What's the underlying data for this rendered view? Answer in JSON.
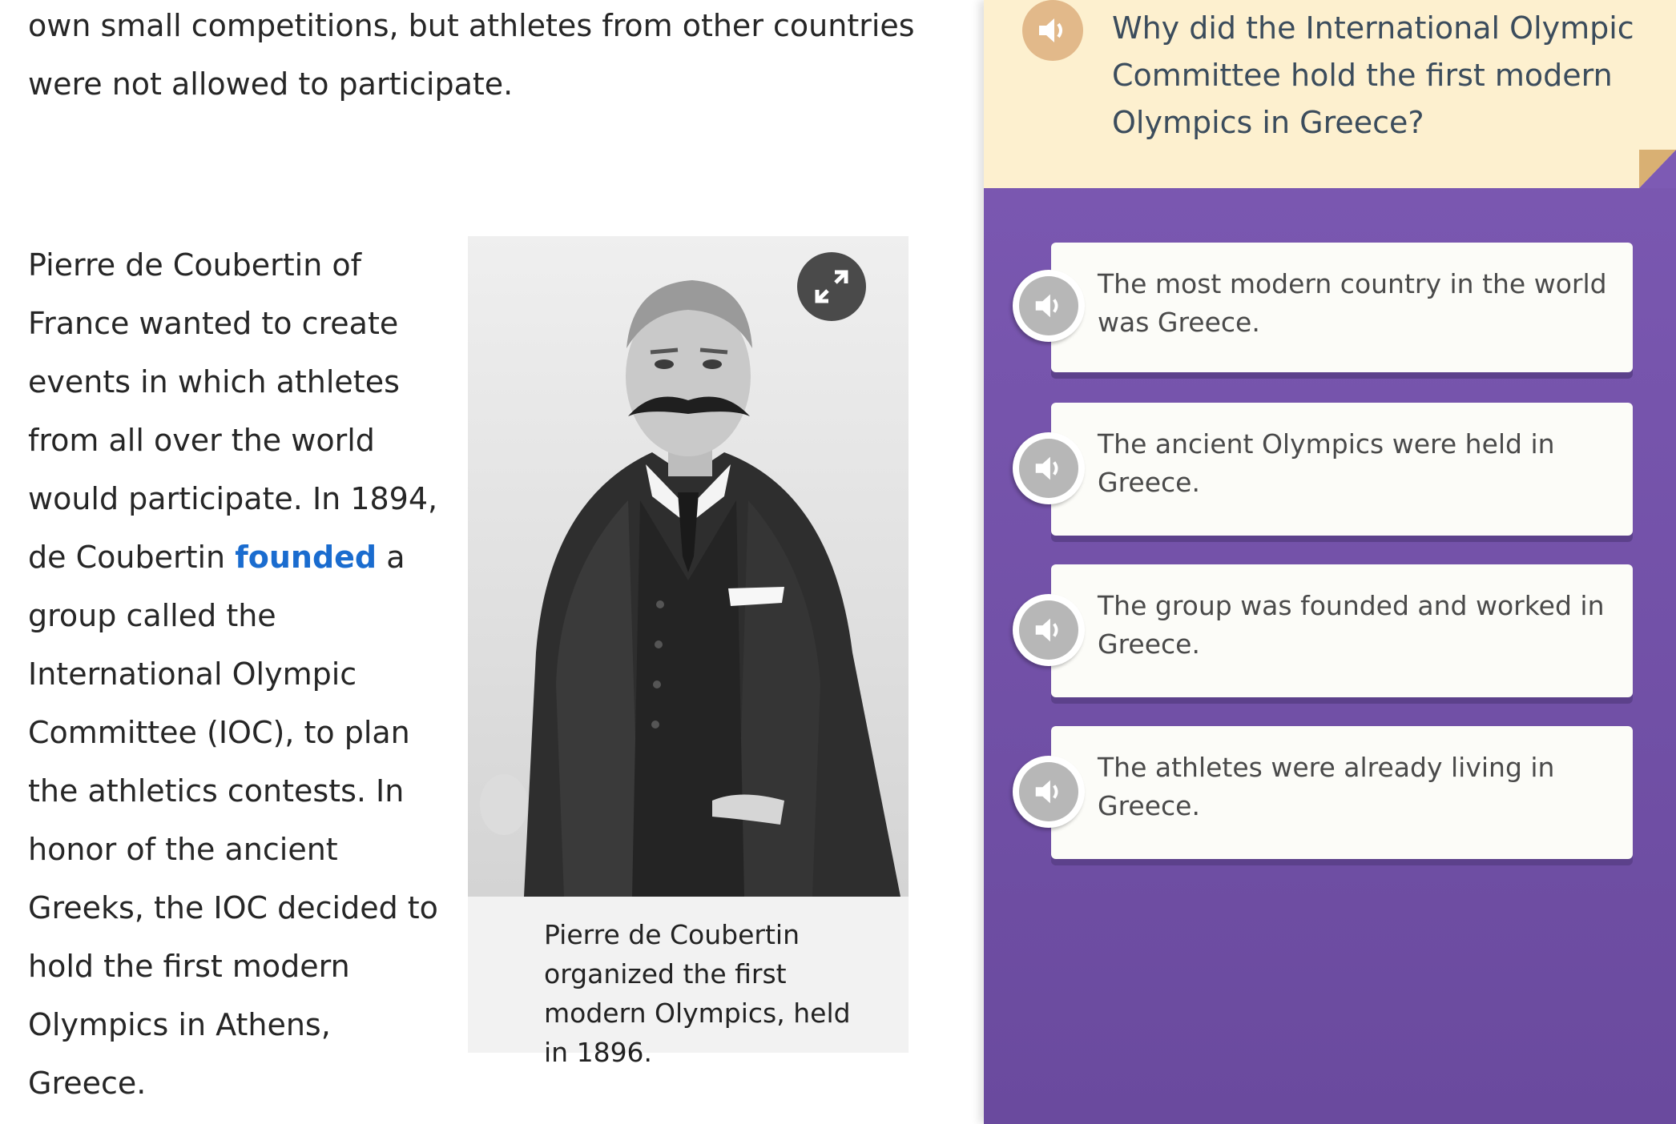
{
  "article": {
    "intro_text": "own small competitions, but athletes from other countries were not allowed to participate.",
    "body_before_link": "Pierre de Coubertin of France wanted to create events in which athletes from all over the world would participate. In 1894, de Coubertin ",
    "link_word": "founded",
    "body_after_link": " a group called the International Olympic Committee (IOC), to plan the athletics contests. In honor of the ancient Greeks, the IOC decided to hold the first modern Olympics in Athens, Greece.",
    "figure": {
      "caption": "Pierre de Coubertin organized the first modern Olympics, held in 1896.",
      "expand_icon": "expand-icon"
    }
  },
  "quiz": {
    "question": "Why did the International Olympic Committee hold the first modern Olympics in Greece?",
    "question_audio_icon": "speaker-icon",
    "answers": [
      {
        "text": "The most modern country in the world was Greece."
      },
      {
        "text": "The ancient Olympics were held in Greece."
      },
      {
        "text": "The group was founded and worked in Greece."
      },
      {
        "text": "The athletes were already living in Greece."
      }
    ]
  },
  "colors": {
    "link": "#1a6ccf",
    "question_bg": "#fdf0cf",
    "panel_purple": "#7d5ab4",
    "answer_bg": "#fcfcf8"
  }
}
